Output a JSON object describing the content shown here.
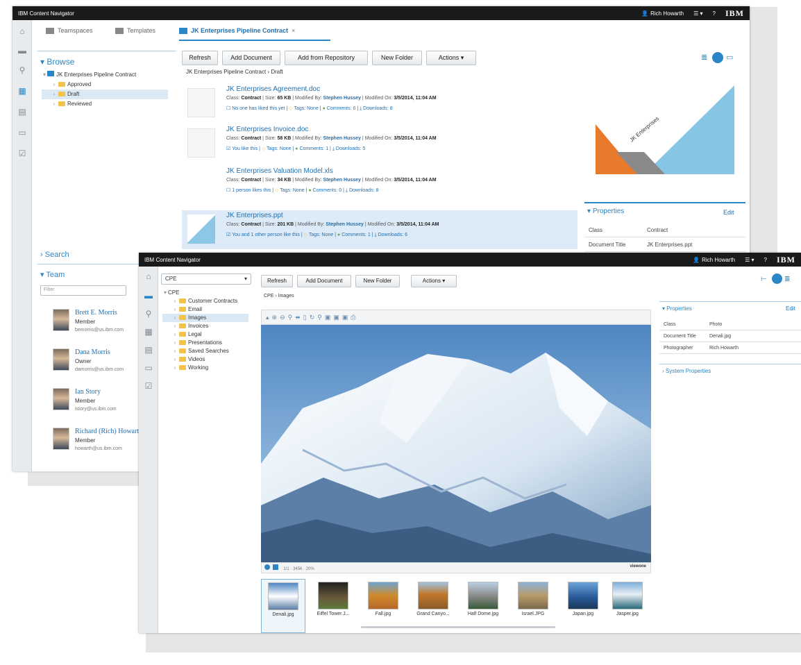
{
  "back_window": {
    "title": "IBM Content Navigator",
    "user": "Rich Howarth",
    "menu_label": "☰ ▾",
    "help_icon": "?",
    "brand": "IBM",
    "tabs": [
      {
        "label": "Teamspaces"
      },
      {
        "label": "Templates"
      },
      {
        "label": "JK Enterprises Pipeline Contract",
        "close": "×"
      }
    ],
    "browse_label": "Browse",
    "tree_root": "JK Enterprises Pipeline Contract",
    "tree_children": [
      "Approved",
      "Draft",
      "Reviewed"
    ],
    "toolbar": [
      "Refresh",
      "Add Document",
      "Add from Repository",
      "New Folder",
      "Actions ▾"
    ],
    "breadcrumb": [
      "JK Enterprises Pipeline Contract",
      "›",
      "Draft"
    ],
    "documents": [
      {
        "name": "JK Enterprises Agreement.doc",
        "size": "65 KB",
        "modified_on": "3/5/2014, 11:04 AM",
        "likes": "No one has liked this yet",
        "comments": "Comments: 0",
        "downloads": "Downloads: 8"
      },
      {
        "name": "JK Enterprises Invoice.doc",
        "size": "58 KB",
        "modified_on": "3/5/2014, 11:04 AM",
        "likes": "You like this",
        "comments": "Comments: 1",
        "downloads": "Downloads: 5"
      },
      {
        "name": "JK Enterprises Valuation Model.xls",
        "size": "34 KB",
        "modified_on": "3/5/2014, 11:04 AM",
        "likes": "1 person likes this",
        "comments": "Comments: 0",
        "downloads": "Downloads: 8"
      },
      {
        "name": "JK Enterprises.ppt",
        "size": "201 KB",
        "modified_on": "3/5/2014, 11:04 AM",
        "likes": "You and 1 other person like this",
        "comments": "Comments: 1",
        "downloads": "Downloads: 6"
      }
    ],
    "meta_labels": {
      "class": "Class:",
      "class_value": "Contract",
      "size": "Size:",
      "modified_by": "Modified By:",
      "modified_by_value": "Stephen Hussey",
      "modified_on": "Modified On:",
      "tags": "Tags: None",
      "sep": "|"
    },
    "preview_text": "JK Enterprises",
    "properties_label": "Properties",
    "edit_label": "Edit",
    "properties": [
      {
        "key": "Class",
        "value": "Contract"
      },
      {
        "key": "Document Title",
        "value": "JK Enterprises.ppt"
      }
    ],
    "search_label": "Search",
    "team_label": "Team",
    "filter_placeholder": "Filter",
    "team": [
      {
        "name": "Brett E. Morris",
        "role": "Member",
        "email": "bemorris@us.ibm.com"
      },
      {
        "name": "Dana Morris",
        "role": "Owner",
        "email": "damorris@us.ibm.com"
      },
      {
        "name": "Ian Story",
        "role": "Member",
        "email": "istory@us.ibm.com"
      },
      {
        "name": "Richard (Rich) Howarth",
        "role": "Member",
        "email": "howarth@us.ibm.com"
      }
    ]
  },
  "front_window": {
    "title": "IBM Content Navigator",
    "user": "Rich Howarth",
    "menu_label": "☰ ▾",
    "help_icon": "?",
    "brand": "IBM",
    "repository": "CPE",
    "tree_root": "CPE",
    "tree_children": [
      "Customer Contracts",
      "Email",
      "Images",
      "Invoices",
      "Legal",
      "Presentations",
      "Saved Searches",
      "Videos",
      "Working"
    ],
    "toolbar": [
      "Refresh",
      "Add Document",
      "New Folder",
      "Actions ▾"
    ],
    "breadcrumb": [
      "CPE",
      "›",
      "Images"
    ],
    "viewer_brand": "viewone",
    "viewer_status": "1/1 · 3456 · 20%",
    "properties_label": "Properties",
    "edit_label": "Edit",
    "properties": [
      {
        "key": "Class",
        "value": "Photo"
      },
      {
        "key": "Document Title",
        "value": "Denali.jpg"
      },
      {
        "key": "Photographer",
        "value": "Rich Howarth"
      }
    ],
    "system_properties_label": "System Properties",
    "thumbnails": [
      "Denali.jpg",
      "Eiffel Tower.J...",
      "Fall.jpg",
      "Grand Canyo...",
      "Half Dome.jpg",
      "Israel.JPG",
      "Japan.jpg",
      "Jasper.jpg"
    ]
  },
  "colors": {
    "accent": "#2a86c6",
    "titlebar": "#1a1a1a",
    "folder": "#f3c24c",
    "link": "#1f6fb2"
  },
  "icons": [
    "home-icon",
    "briefcase-icon",
    "search-icon",
    "calendar-icon",
    "document-icon",
    "folder-icon",
    "checklist-icon",
    "user-icon",
    "help-icon",
    "star-icon",
    "comment-icon",
    "download-icon"
  ]
}
